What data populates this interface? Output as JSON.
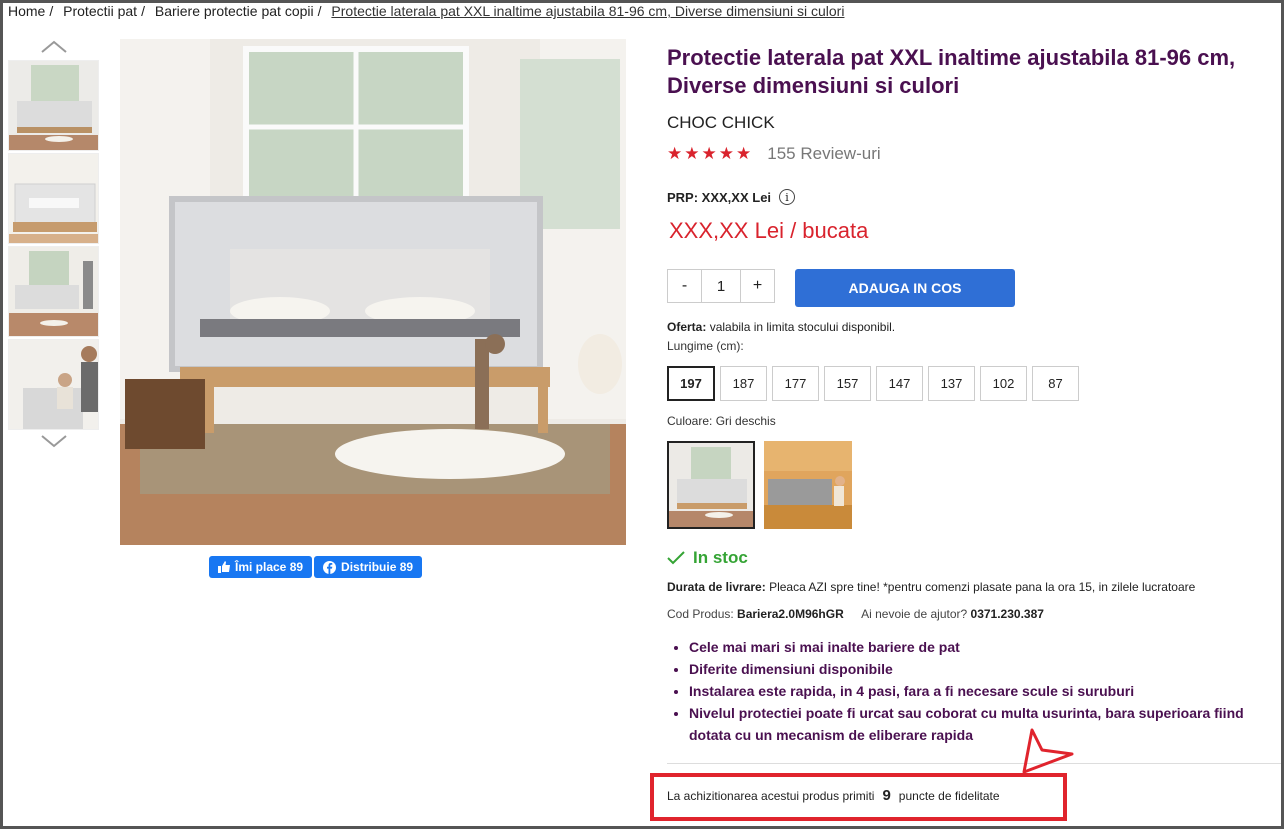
{
  "breadcrumb": {
    "items": [
      "Home",
      "Protectii pat",
      "Bariere protectie pat copii"
    ],
    "current": "Protectie laterala pat XXL inaltime ajustabila 81-96 cm, Diverse dimensiuni si culori"
  },
  "product": {
    "title": "Protectie laterala pat XXL inaltime ajustabila 81-96 cm, Diverse dimensiuni si culori",
    "brand": "CHOC CHICK",
    "rating_stars": 5,
    "reviews": "155 Review-uri",
    "prp": "PRP: XXX,XX Lei",
    "price": "XXX,XX Lei / bucata",
    "quantity": "1",
    "qty_minus": "-",
    "qty_plus": "+",
    "add_to_cart": "ADAUGA IN COS",
    "offer_label": "Oferta:",
    "offer_text": "valabila in limita stocului disponibil.",
    "length_label": "Lungime (cm):",
    "sizes": [
      "197",
      "187",
      "177",
      "157",
      "147",
      "137",
      "102",
      "87"
    ],
    "selected_size": "197",
    "color_label": "Culoare: Gri deschis",
    "stock": "In stoc",
    "delivery_label": "Durata de livrare:",
    "delivery_text": "Pleaca AZI spre tine! *pentru comenzi plasate pana la ora 15, in zilele lucratoare",
    "code_label": "Cod Produs:",
    "code_value": "Bariera2.0M96hGR",
    "help_label": "Ai nevoie de ajutor?",
    "help_phone": "0371.230.387",
    "bullets": [
      "Cele mai mari si mai inalte bariere de pat",
      "Diferite dimensiuni disponibile",
      "Instalarea este rapida, in 4 pasi, fara a fi necesare scule si suruburi",
      "Nivelul protectiei poate fi urcat sau coborat cu multa usurinta, bara superioara fiind dotata cu un mecanism de eliberare rapida"
    ],
    "loyalty_pre": "La achizitionarea acestui produs primiti",
    "loyalty_points": "9",
    "loyalty_post": "puncte de fidelitate"
  },
  "social": {
    "like": "Îmi place 89",
    "share": "Distribuie 89"
  },
  "colors": {
    "title": "#4a1050",
    "price": "#d9232d",
    "button": "#2f6fd6",
    "stock": "#35a435",
    "highlight": "#e0242d"
  }
}
